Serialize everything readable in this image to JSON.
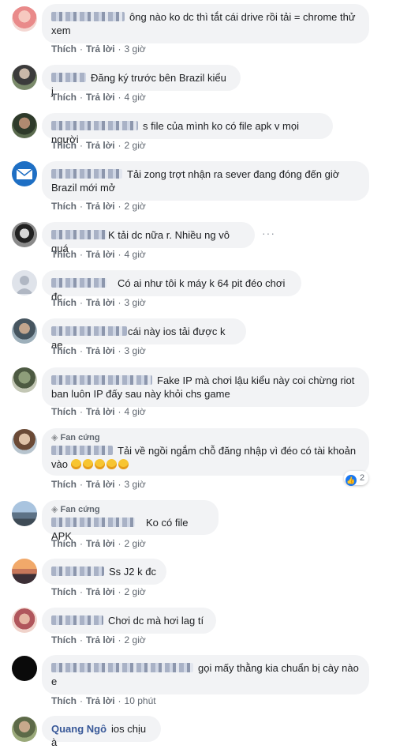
{
  "labels": {
    "like": "Thích",
    "reply": "Trả lời",
    "fan_badge": "Fan cứng"
  },
  "comments": [
    {
      "text": "ông nào ko dc thì tắt cái drive rồi tải = chrome thử xem",
      "time": "3 giờ"
    },
    {
      "text": "Đăng ký trước bên Brazil kiểu j",
      "time": "4 giờ"
    },
    {
      "text": "s file của mình ko có file apk v mọi người",
      "time": "2 giờ"
    },
    {
      "text": "Tải zong trợt nhận ra sever đang đóng đến giờ Brazil mới mở",
      "time": "2 giờ"
    },
    {
      "text": "K tải dc nữa r. Nhiều ng vô quá",
      "time": "4 giờ"
    },
    {
      "text": "Có ai như tôi k máy k 64 pit đéo chơi đc",
      "time": "3 giờ"
    },
    {
      "text": "cái này ios tải được k ae",
      "time": "3 giờ"
    },
    {
      "text": "Fake IP mà chơi lậu kiểu này coi chừng riot ban luôn IP đấy sau này khỏi chs game",
      "time": "4 giờ"
    },
    {
      "text": "Tải về ngồi ngắm chỗ đăng nhập vì đéo có tài khoản vào",
      "time": "3 giờ",
      "reactions": "2"
    },
    {
      "text": "Ko có file APK",
      "time": "2 giờ"
    },
    {
      "text": "Ss J2 k đc",
      "time": "2 giờ"
    },
    {
      "text": "Chơi dc mà hơi lag tí",
      "time": "2 giờ"
    },
    {
      "text": "gọi mấy thằng kia chuẩn bị cày nào e",
      "time": "10 phút"
    },
    {
      "name": "Quang Ngô",
      "text": "ios chịu à"
    }
  ],
  "colors": {
    "bubble": "#f2f3f5",
    "name": "#385898",
    "meta": "#606770",
    "like": "#1877f2"
  },
  "icons": [
    "more-options-icon",
    "like-reaction-icon",
    "diamond-badge-icon",
    "rofl-emoji-icon"
  ]
}
